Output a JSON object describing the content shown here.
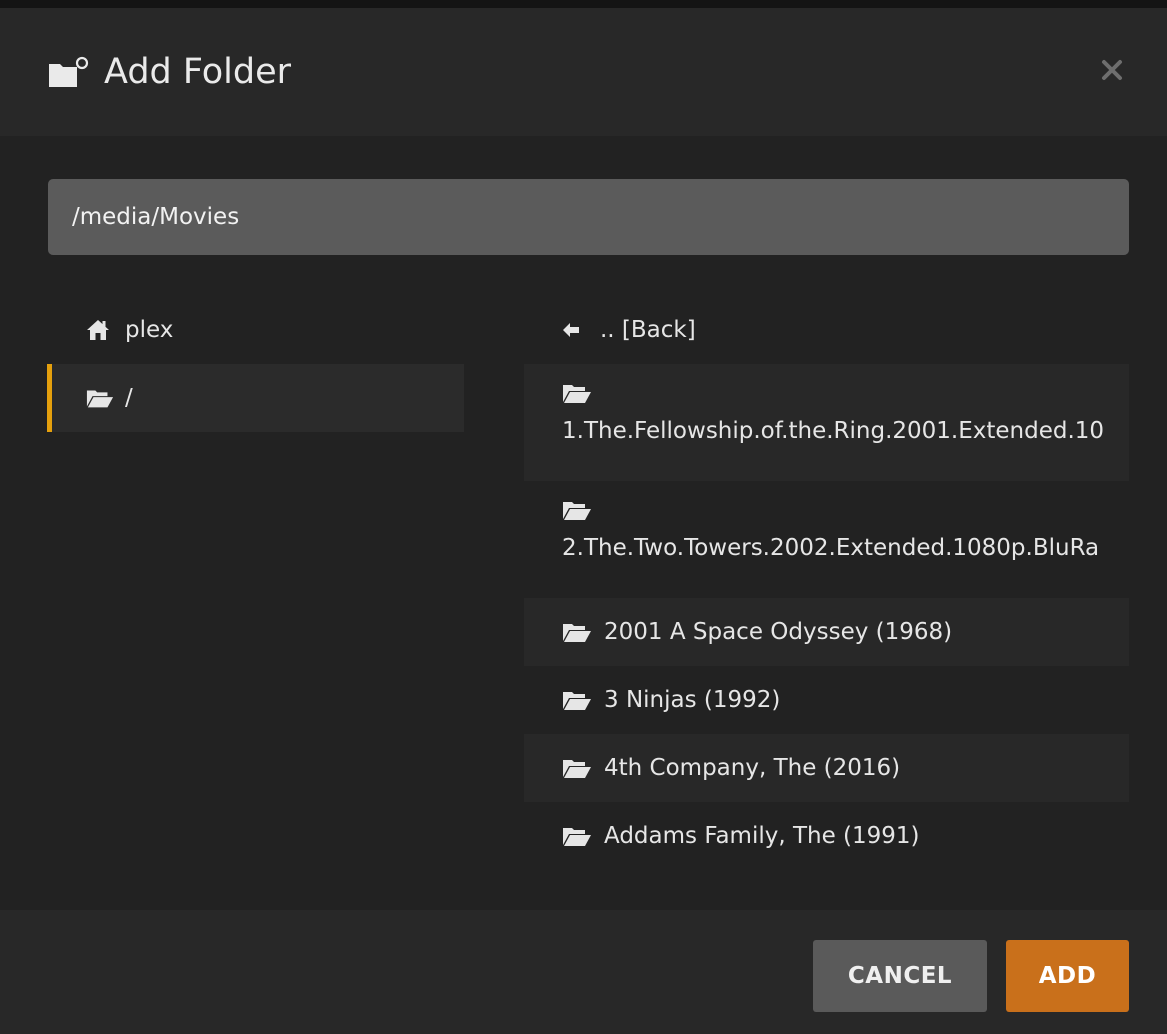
{
  "dialog": {
    "title": "Add Folder",
    "icons": {
      "title": "add-folder-icon",
      "close": "close-icon"
    }
  },
  "path_field": {
    "value": "/media/Movies"
  },
  "sidebar": {
    "items": [
      {
        "label": "plex",
        "icon": "home-icon",
        "selected": false
      },
      {
        "label": "/",
        "icon": "folder-open-icon",
        "selected": true
      }
    ]
  },
  "files": {
    "back_label": ".. [Back]",
    "back_icon": "arrow-left-icon",
    "items": [
      {
        "name": "1.The.Fellowship.of.the.Ring.2001.Extended.10",
        "icon": "folder-open-icon"
      },
      {
        "name": "2.The.Two.Towers.2002.Extended.1080p.BluRa",
        "icon": "folder-open-icon"
      },
      {
        "name": "2001 A Space Odyssey (1968)",
        "icon": "folder-open-icon"
      },
      {
        "name": "3 Ninjas (1992)",
        "icon": "folder-open-icon"
      },
      {
        "name": "4th Company, The (2016)",
        "icon": "folder-open-icon"
      },
      {
        "name": "Addams Family, The (1991)",
        "icon": "folder-open-icon"
      }
    ]
  },
  "footer": {
    "cancel_label": "CANCEL",
    "add_label": "ADD"
  },
  "colors": {
    "accent": "#e5a00d",
    "add_button": "#c9701b",
    "cancel_button": "#5a5a5a",
    "background": "#222222",
    "header_footer": "#282828",
    "input": "#5b5b5b"
  }
}
